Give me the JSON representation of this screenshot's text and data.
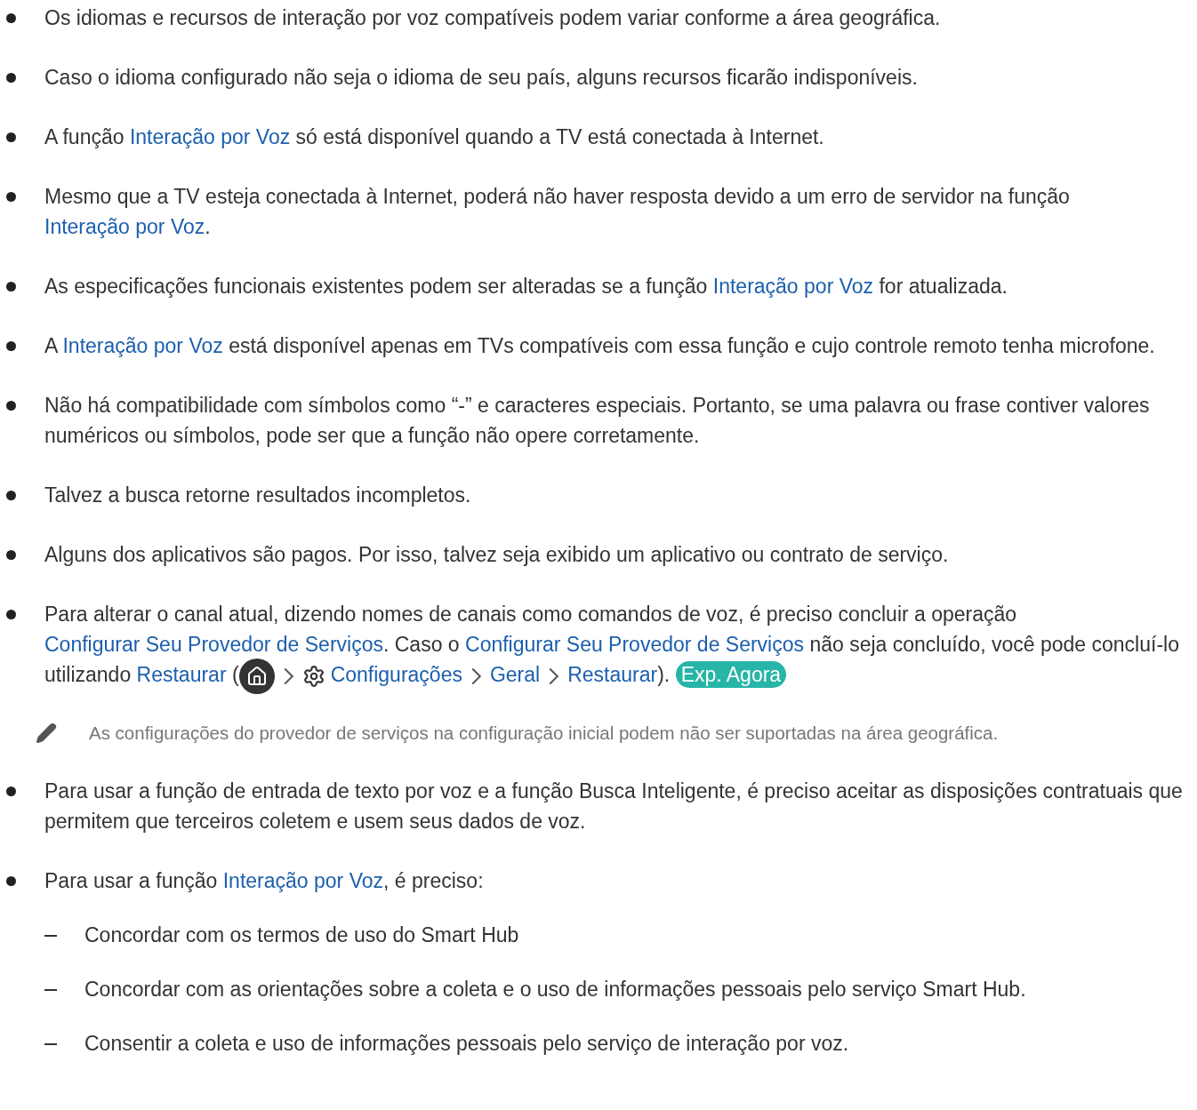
{
  "items": [
    {
      "kind": "bullet",
      "segments": [
        {
          "kind": "text",
          "text": "Os idiomas e recursos de interação por voz compatíveis podem variar conforme a área geográfica."
        }
      ]
    },
    {
      "kind": "bullet",
      "segments": [
        {
          "kind": "text",
          "text": "Caso o idioma configurado não seja o idioma de seu país, alguns recursos ficarão indisponíveis."
        }
      ]
    },
    {
      "kind": "bullet",
      "segments": [
        {
          "kind": "text",
          "text": "A função "
        },
        {
          "kind": "link",
          "text": "Interação por Voz"
        },
        {
          "kind": "text",
          "text": " só está disponível quando a TV está conectada à Internet."
        }
      ]
    },
    {
      "kind": "bullet",
      "segments": [
        {
          "kind": "text",
          "text": "Mesmo que a TV esteja conectada à Internet, poderá não haver resposta devido a um erro de servidor na função "
        },
        {
          "kind": "link",
          "text": "Interação por Voz"
        },
        {
          "kind": "text",
          "text": "."
        }
      ]
    },
    {
      "kind": "bullet",
      "segments": [
        {
          "kind": "text",
          "text": "As especificações funcionais existentes podem ser alteradas se a função "
        },
        {
          "kind": "link",
          "text": "Interação por Voz"
        },
        {
          "kind": "text",
          "text": " for atualizada."
        }
      ]
    },
    {
      "kind": "bullet",
      "segments": [
        {
          "kind": "text",
          "text": "A "
        },
        {
          "kind": "link",
          "text": "Interação por Voz"
        },
        {
          "kind": "text",
          "text": " está disponível apenas em TVs compatíveis com essa função e cujo controle remoto tenha microfone."
        }
      ]
    },
    {
      "kind": "bullet",
      "segments": [
        {
          "kind": "text",
          "text": "Não há compatibilidade com símbolos como “-” e caracteres especiais. Portanto, se uma palavra ou frase contiver valores numéricos ou símbolos, pode ser que a função não opere corretamente."
        }
      ]
    },
    {
      "kind": "bullet",
      "segments": [
        {
          "kind": "text",
          "text": "Talvez a busca retorne resultados incompletos."
        }
      ]
    },
    {
      "kind": "bullet",
      "segments": [
        {
          "kind": "text",
          "text": "Alguns dos aplicativos são pagos. Por isso, talvez seja exibido um aplicativo ou contrato de serviço."
        }
      ]
    },
    {
      "kind": "bullet",
      "segments": [
        {
          "kind": "text",
          "text": "Para alterar o canal atual, dizendo nomes de canais como comandos de voz, é preciso concluir a operação "
        },
        {
          "kind": "link",
          "text": "Configurar Seu Provedor de Serviços"
        },
        {
          "kind": "text",
          "text": ". Caso o "
        },
        {
          "kind": "link",
          "text": "Configurar Seu Provedor de Serviços"
        },
        {
          "kind": "text",
          "text": " não seja concluído, você pode concluí-lo utilizando "
        },
        {
          "kind": "link",
          "text": "Restaurar"
        },
        {
          "kind": "text",
          "text": " ("
        },
        {
          "kind": "home"
        },
        {
          "kind": "sep"
        },
        {
          "kind": "settings"
        },
        {
          "kind": "link",
          "text": "Configurações"
        },
        {
          "kind": "sep"
        },
        {
          "kind": "link",
          "text": "Geral"
        },
        {
          "kind": "sep"
        },
        {
          "kind": "link",
          "text": "Restaurar"
        },
        {
          "kind": "text",
          "text": "). "
        },
        {
          "kind": "button",
          "text": "Exp. Agora"
        }
      ]
    },
    {
      "kind": "note",
      "segments": [
        {
          "kind": "text",
          "text": "As configurações do provedor de serviços na configuração inicial podem não ser suportadas na área geográfica."
        }
      ]
    },
    {
      "kind": "bullet",
      "segments": [
        {
          "kind": "text",
          "text": "Para usar a função de entrada de texto por voz e a função Busca Inteligente, é preciso aceitar as disposições contratuais que permitem que terceiros coletem e usem seus dados de voz."
        }
      ]
    },
    {
      "kind": "bullet",
      "segments": [
        {
          "kind": "text",
          "text": "Para usar a função "
        },
        {
          "kind": "link",
          "text": "Interação por Voz"
        },
        {
          "kind": "text",
          "text": ", é preciso:"
        }
      ],
      "children": [
        {
          "segments": [
            {
              "kind": "text",
              "text": "Concordar com os termos de uso do Smart Hub"
            }
          ]
        },
        {
          "segments": [
            {
              "kind": "text",
              "text": "Concordar com as orientações sobre a coleta e o uso de informações pessoais pelo serviço Smart Hub."
            }
          ]
        },
        {
          "segments": [
            {
              "kind": "text",
              "text": "Consentir a coleta e uso de informações pessoais pelo serviço de interação por voz."
            }
          ]
        }
      ]
    }
  ]
}
